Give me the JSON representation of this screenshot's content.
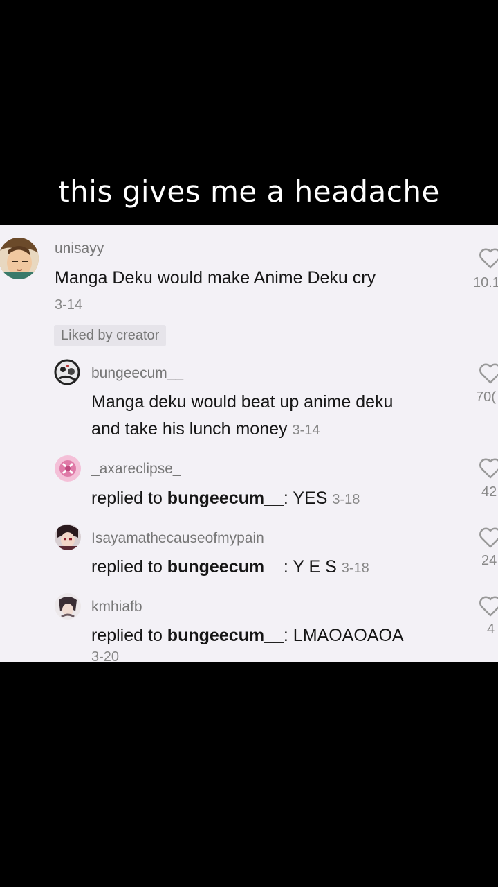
{
  "caption": "this gives me a headache",
  "comment": {
    "username": "unisayy",
    "text": "Manga Deku would make Anime Deku cry",
    "date": "3-14",
    "likes": "10.1",
    "liked_by_creator": "Liked by creator"
  },
  "replies": [
    {
      "username": "bungeecum__",
      "line1": "Manga deku would beat up anime deku",
      "line2": "and take his lunch money",
      "date": "3-14",
      "likes": "70("
    },
    {
      "username": "_axareclipse_",
      "prefix": "replied to ",
      "target": "bungeecum__",
      "suffix": ": YES",
      "date": "3-18",
      "likes": "42"
    },
    {
      "username": "Isayamathecauseofmypain",
      "prefix": "replied to ",
      "target": "bungeecum__",
      "suffix": ": Y E S",
      "date": "3-18",
      "likes": "24"
    },
    {
      "username": "kmhiafb",
      "prefix": "replied to ",
      "target": "bungeecum__",
      "suffix": ": LMAOAOAOA",
      "date": "3-20",
      "likes": "4"
    }
  ]
}
